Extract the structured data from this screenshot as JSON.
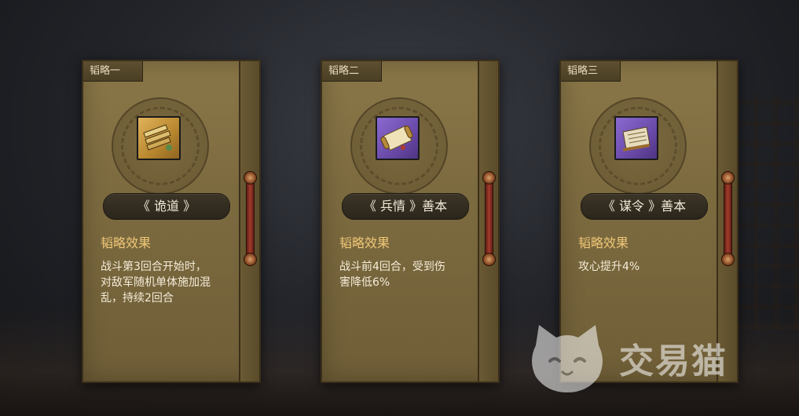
{
  "cards": [
    {
      "header": "韬略一",
      "icon": "bamboo-scroll-bundle-icon",
      "icon_color": "#c89a45",
      "name": "《 诡道 》",
      "effect_title": "韬略效果",
      "effect_text": "战斗第3回合开始时，\n对敌军随机单体施加混\n乱，持续2回合"
    },
    {
      "header": "韬略二",
      "icon": "scroll-icon",
      "icon_color": "#6a4aa8",
      "name": "《 兵情 》善本",
      "effect_title": "韬略效果",
      "effect_text": "战斗前4回合，受到伤\n害降低6%"
    },
    {
      "header": "韬略三",
      "icon": "book-icon",
      "icon_color": "#6a4aa8",
      "name": "《 谋令 》善本",
      "effect_title": "韬略效果",
      "effect_text": "攻心提升4%"
    }
  ],
  "watermark": {
    "text": "交易猫",
    "icon": "cat-face-logo-icon"
  }
}
